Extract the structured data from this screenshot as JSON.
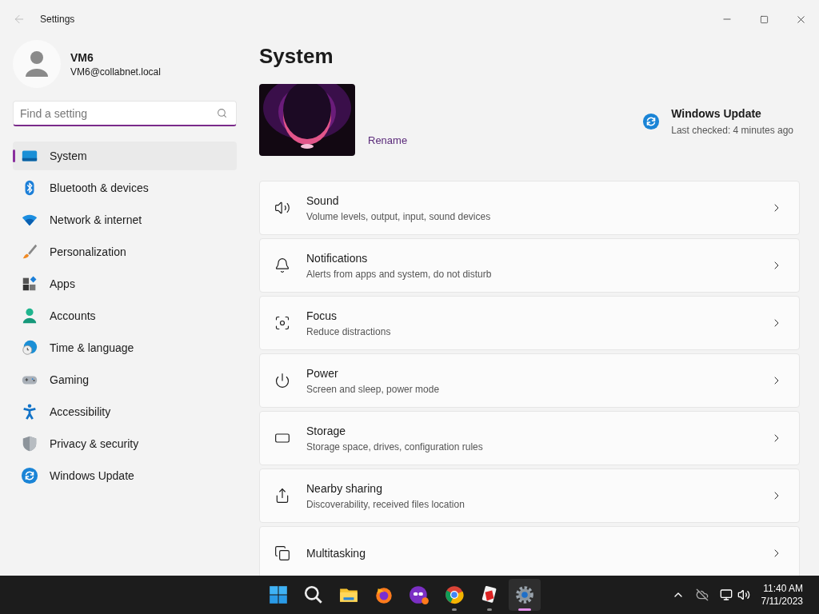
{
  "window": {
    "title": "Settings"
  },
  "account": {
    "name": "VM6",
    "email": "VM6@collabnet.local"
  },
  "search": {
    "placeholder": "Find a setting"
  },
  "sidebar": {
    "items": [
      {
        "label": "System",
        "kind": "system",
        "selected": true
      },
      {
        "label": "Bluetooth & devices",
        "kind": "bluetooth",
        "selected": false
      },
      {
        "label": "Network & internet",
        "kind": "wifi",
        "selected": false
      },
      {
        "label": "Personalization",
        "kind": "brush",
        "selected": false
      },
      {
        "label": "Apps",
        "kind": "apps",
        "selected": false
      },
      {
        "label": "Accounts",
        "kind": "person",
        "selected": false
      },
      {
        "label": "Time & language",
        "kind": "globe",
        "selected": false
      },
      {
        "label": "Gaming",
        "kind": "gamepad",
        "selected": false
      },
      {
        "label": "Accessibility",
        "kind": "accessibility",
        "selected": false
      },
      {
        "label": "Privacy & security",
        "kind": "shield",
        "selected": false
      },
      {
        "label": "Windows Update",
        "kind": "update",
        "selected": false
      }
    ]
  },
  "page": {
    "title": "System",
    "rename": "Rename",
    "update": {
      "title": "Windows Update",
      "status": "Last checked: 4 minutes ago"
    }
  },
  "cards": [
    {
      "title": "Sound",
      "subtitle": "Volume levels, output, input, sound devices",
      "kind": "speaker"
    },
    {
      "title": "Notifications",
      "subtitle": "Alerts from apps and system, do not disturb",
      "kind": "bell"
    },
    {
      "title": "Focus",
      "subtitle": "Reduce distractions",
      "kind": "focus"
    },
    {
      "title": "Power",
      "subtitle": "Screen and sleep, power mode",
      "kind": "power"
    },
    {
      "title": "Storage",
      "subtitle": "Storage space, drives, configuration rules",
      "kind": "storage"
    },
    {
      "title": "Nearby sharing",
      "subtitle": "Discoverability, received files location",
      "kind": "share"
    },
    {
      "title": "Multitasking",
      "kind": "windows"
    }
  ],
  "taskbar": {
    "apps": [
      {
        "kind": "start",
        "running": false,
        "selected": false
      },
      {
        "kind": "search",
        "running": false,
        "selected": false
      },
      {
        "kind": "folder",
        "running": false,
        "selected": false
      },
      {
        "kind": "firefox",
        "running": false,
        "selected": false
      },
      {
        "kind": "mask",
        "running": false,
        "selected": false
      },
      {
        "kind": "chrome",
        "running": true,
        "selected": false
      },
      {
        "kind": "red-app",
        "running": true,
        "selected": false
      },
      {
        "kind": "gear",
        "running": true,
        "selected": true
      }
    ],
    "time": "11:40 AM",
    "date": "7/11/2023"
  }
}
